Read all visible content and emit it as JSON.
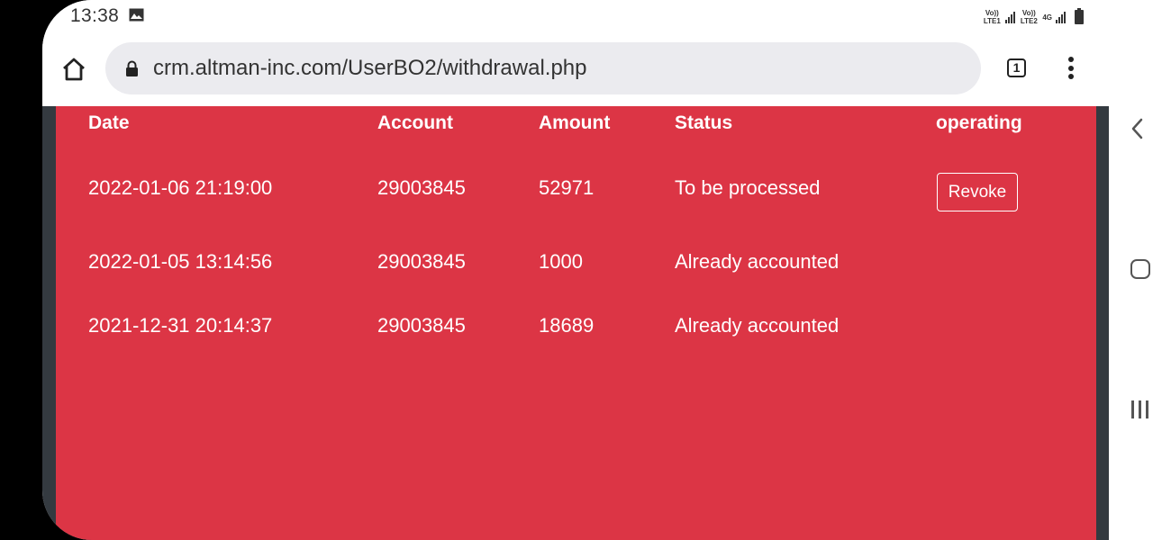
{
  "status_bar": {
    "time": "13:38",
    "sim1_label": "Vo)) LTE1",
    "sim2_label": "Vo)) LTE2",
    "network_label": "4G"
  },
  "browser": {
    "url": "crm.altman-inc.com/UserBO2/withdrawal.php",
    "tab_count": "1"
  },
  "table": {
    "headers": [
      "Date",
      "Account",
      "Amount",
      "Status",
      "operating"
    ],
    "rows": [
      {
        "date": "2022-01-06 21:19:00",
        "account": "29003845",
        "amount": "52971",
        "status": "To be processed",
        "action": "Revoke"
      },
      {
        "date": "2022-01-05 13:14:56",
        "account": "29003845",
        "amount": "1000",
        "status": "Already accounted",
        "action": ""
      },
      {
        "date": "2021-12-31 20:14:37",
        "account": "29003845",
        "amount": "18689",
        "status": "Already accounted",
        "action": ""
      }
    ]
  },
  "colors": {
    "panel": "#dc3545",
    "dark_border": "#343a40"
  },
  "icons": {
    "status": [
      "image-icon",
      "signal-icon",
      "battery-icon"
    ],
    "browser": [
      "home-icon",
      "lock-icon",
      "tab-switcher-icon",
      "more-vert-icon"
    ],
    "nav": [
      "back-icon",
      "home-nav-icon",
      "recent-apps-icon"
    ]
  }
}
